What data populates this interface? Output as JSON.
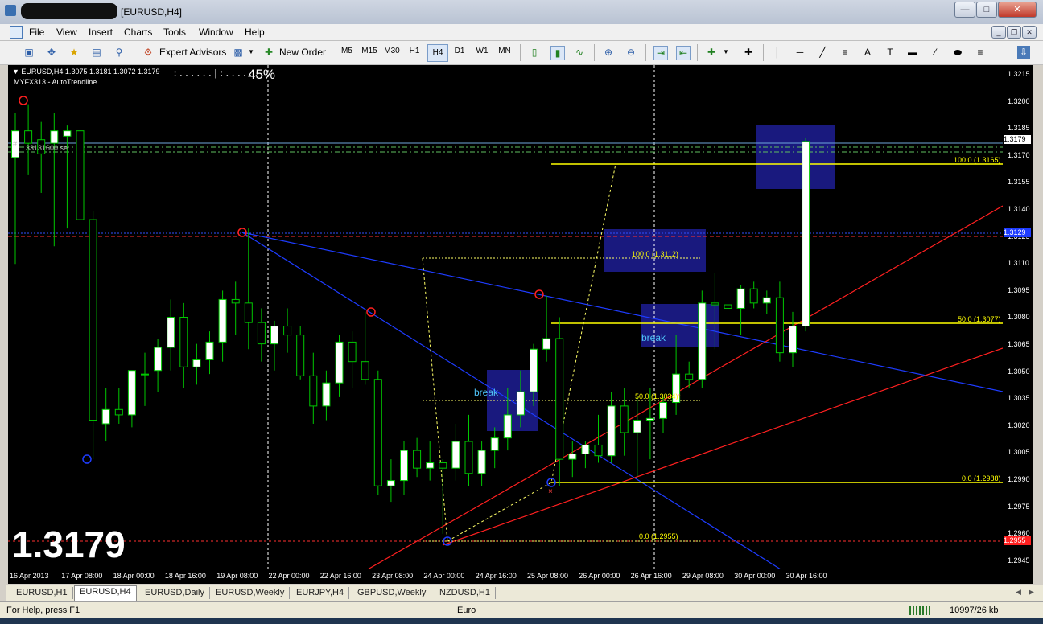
{
  "window": {
    "title": "[EURUSD,H4]"
  },
  "menu": [
    "File",
    "View",
    "Insert",
    "Charts",
    "Tools",
    "Window",
    "Help"
  ],
  "toolbar": {
    "expert_advisors": "Expert Advisors",
    "new_order": "New Order",
    "timeframes": [
      "M5",
      "M15",
      "M30",
      "H1",
      "H4",
      "D1",
      "W1",
      "MN"
    ],
    "active_timeframe": "H4"
  },
  "chart": {
    "header_line": "EURUSD,H4  1.3075 1.3181 1.3072 1.3179",
    "indicator": "MYFX313 - AutoTrendline",
    "progress_text": ":......|:.......:",
    "progress_percent": "45%",
    "big_price": "1.3179",
    "overlay_label_1": "#1",
    "overlay_label_2": "33131600 se",
    "annotations": {
      "break_1": "break",
      "break_2": "break",
      "fib_a_100": "100.0 (1.3165)",
      "fib_a_50": "50.0 (1.3077)",
      "fib_a_0": "0.0 (1.2988)",
      "fib_b_100": "100.0 (1.3112)",
      "fib_b_50": "50.0 (1.3034)",
      "fib_b_0": "0.0 (1.2955)"
    },
    "colors": {
      "bull": "#ffffff",
      "bear": "#000000",
      "wick": "#00c800",
      "fib": "#ffff00",
      "box": "#1c1c8c",
      "blue_line": "#1e3cff",
      "red_line": "#ff2020",
      "break_text": "#4fc3f7"
    }
  },
  "price_axis": {
    "labels": [
      "1.3215",
      "1.3200",
      "1.3185",
      "1.3170",
      "1.3155",
      "1.3140",
      "1.3125",
      "1.3110",
      "1.3095",
      "1.3080",
      "1.3065",
      "1.3050",
      "1.3035",
      "1.3020",
      "1.3005",
      "1.2990",
      "1.2975",
      "1.2960",
      "1.2945"
    ],
    "current_price": "1.3179",
    "red_marker": "1.2955",
    "blue_marker": "1.3129"
  },
  "time_axis": {
    "labels": [
      "16 Apr 2013",
      "17 Apr 08:00",
      "18 Apr 00:00",
      "18 Apr 16:00",
      "19 Apr 08:00",
      "22 Apr 00:00",
      "22 Apr 16:00",
      "23 Apr 08:00",
      "24 Apr 00:00",
      "24 Apr 16:00",
      "25 Apr 08:00",
      "26 Apr 00:00",
      "26 Apr 16:00",
      "29 Apr 08:00",
      "30 Apr 00:00",
      "30 Apr 16:00"
    ]
  },
  "tabs": [
    "EURUSD,H1",
    "EURUSD,H4",
    "EURUSD,Daily",
    "EURUSD,Weekly",
    "EURJPY,H4",
    "GBPUSD,Weekly",
    "NZDUSD,H1"
  ],
  "active_tab": "EURUSD,H4",
  "status": {
    "help": "For Help, press F1",
    "profile": "Euro",
    "traffic": "10997/26 kb"
  },
  "chart_data": {
    "type": "candlestick",
    "symbol": "EURUSD",
    "timeframe": "H4",
    "ylim": [
      1.2938,
      1.3222
    ],
    "candles": [
      {
        "o": 1.317,
        "h": 1.3195,
        "l": 1.311,
        "c": 1.3185
      },
      {
        "o": 1.3185,
        "h": 1.32,
        "l": 1.316,
        "c": 1.3178
      },
      {
        "o": 1.318,
        "h": 1.319,
        "l": 1.315,
        "c": 1.3172
      },
      {
        "o": 1.3178,
        "h": 1.3195,
        "l": 1.312,
        "c": 1.3185
      },
      {
        "o": 1.3182,
        "h": 1.3188,
        "l": 1.313,
        "c": 1.3185
      },
      {
        "o": 1.3185,
        "h": 1.3188,
        "l": 1.314,
        "c": 1.3135
      },
      {
        "o": 1.3135,
        "h": 1.314,
        "l": 1.3,
        "c": 1.3022
      },
      {
        "o": 1.302,
        "h": 1.304,
        "l": 1.301,
        "c": 1.3028
      },
      {
        "o": 1.3028,
        "h": 1.304,
        "l": 1.302,
        "c": 1.3025
      },
      {
        "o": 1.3025,
        "h": 1.3048,
        "l": 1.3018,
        "c": 1.305
      },
      {
        "o": 1.3048,
        "h": 1.306,
        "l": 1.303,
        "c": 1.3048
      },
      {
        "o": 1.305,
        "h": 1.3068,
        "l": 1.3038,
        "c": 1.3063
      },
      {
        "o": 1.3063,
        "h": 1.309,
        "l": 1.305,
        "c": 1.308
      },
      {
        "o": 1.308,
        "h": 1.3088,
        "l": 1.304,
        "c": 1.3052
      },
      {
        "o": 1.3052,
        "h": 1.3065,
        "l": 1.3042,
        "c": 1.3056
      },
      {
        "o": 1.3056,
        "h": 1.3072,
        "l": 1.3048,
        "c": 1.3066
      },
      {
        "o": 1.3066,
        "h": 1.3095,
        "l": 1.3055,
        "c": 1.309
      },
      {
        "o": 1.309,
        "h": 1.31,
        "l": 1.307,
        "c": 1.3088
      },
      {
        "o": 1.3088,
        "h": 1.313,
        "l": 1.3062,
        "c": 1.3077
      },
      {
        "o": 1.3077,
        "h": 1.3085,
        "l": 1.3055,
        "c": 1.3065
      },
      {
        "o": 1.3065,
        "h": 1.3078,
        "l": 1.305,
        "c": 1.3075
      },
      {
        "o": 1.3075,
        "h": 1.3085,
        "l": 1.306,
        "c": 1.307
      },
      {
        "o": 1.307,
        "h": 1.3075,
        "l": 1.3045,
        "c": 1.3047
      },
      {
        "o": 1.3047,
        "h": 1.306,
        "l": 1.302,
        "c": 1.303
      },
      {
        "o": 1.303,
        "h": 1.305,
        "l": 1.3022,
        "c": 1.3043
      },
      {
        "o": 1.3043,
        "h": 1.307,
        "l": 1.3035,
        "c": 1.3066
      },
      {
        "o": 1.3066,
        "h": 1.3072,
        "l": 1.304,
        "c": 1.3055
      },
      {
        "o": 1.3055,
        "h": 1.3083,
        "l": 1.3042,
        "c": 1.3045
      },
      {
        "o": 1.3045,
        "h": 1.305,
        "l": 1.298,
        "c": 1.2985
      },
      {
        "o": 1.2985,
        "h": 1.3,
        "l": 1.2976,
        "c": 1.2988
      },
      {
        "o": 1.2988,
        "h": 1.301,
        "l": 1.298,
        "c": 1.3005
      },
      {
        "o": 1.3005,
        "h": 1.3012,
        "l": 1.299,
        "c": 1.2995
      },
      {
        "o": 1.2995,
        "h": 1.301,
        "l": 1.2988,
        "c": 1.2998
      },
      {
        "o": 1.2998,
        "h": 1.3,
        "l": 1.2958,
        "c": 1.2995
      },
      {
        "o": 1.2995,
        "h": 1.302,
        "l": 1.2988,
        "c": 1.301
      },
      {
        "o": 1.301,
        "h": 1.3025,
        "l": 1.2985,
        "c": 1.2992
      },
      {
        "o": 1.2992,
        "h": 1.301,
        "l": 1.2985,
        "c": 1.3005
      },
      {
        "o": 1.3005,
        "h": 1.3018,
        "l": 1.2995,
        "c": 1.3012
      },
      {
        "o": 1.3012,
        "h": 1.304,
        "l": 1.3005,
        "c": 1.3025
      },
      {
        "o": 1.3025,
        "h": 1.305,
        "l": 1.3018,
        "c": 1.3038
      },
      {
        "o": 1.3038,
        "h": 1.3065,
        "l": 1.303,
        "c": 1.3062
      },
      {
        "o": 1.3062,
        "h": 1.3092,
        "l": 1.3055,
        "c": 1.3068
      },
      {
        "o": 1.3068,
        "h": 1.308,
        "l": 1.2985,
        "c": 1.3
      },
      {
        "o": 1.3,
        "h": 1.301,
        "l": 1.299,
        "c": 1.3003
      },
      {
        "o": 1.3003,
        "h": 1.301,
        "l": 1.2995,
        "c": 1.3008
      },
      {
        "o": 1.3008,
        "h": 1.3025,
        "l": 1.2998,
        "c": 1.3002
      },
      {
        "o": 1.3002,
        "h": 1.3038,
        "l": 1.2998,
        "c": 1.303
      },
      {
        "o": 1.303,
        "h": 1.304,
        "l": 1.3002,
        "c": 1.3015
      },
      {
        "o": 1.3015,
        "h": 1.3035,
        "l": 1.299,
        "c": 1.3022
      },
      {
        "o": 1.3022,
        "h": 1.304,
        "l": 1.3,
        "c": 1.3023
      },
      {
        "o": 1.3023,
        "h": 1.3035,
        "l": 1.3015,
        "c": 1.3032
      },
      {
        "o": 1.3032,
        "h": 1.307,
        "l": 1.3025,
        "c": 1.3048
      },
      {
        "o": 1.3048,
        "h": 1.3055,
        "l": 1.304,
        "c": 1.3045
      },
      {
        "o": 1.3045,
        "h": 1.3095,
        "l": 1.304,
        "c": 1.3088
      },
      {
        "o": 1.3088,
        "h": 1.3105,
        "l": 1.3062,
        "c": 1.3087
      },
      {
        "o": 1.3087,
        "h": 1.3095,
        "l": 1.308,
        "c": 1.3085
      },
      {
        "o": 1.3085,
        "h": 1.3098,
        "l": 1.307,
        "c": 1.3096
      },
      {
        "o": 1.3096,
        "h": 1.31,
        "l": 1.3085,
        "c": 1.3088
      },
      {
        "o": 1.3088,
        "h": 1.3095,
        "l": 1.3082,
        "c": 1.3091
      },
      {
        "o": 1.3091,
        "h": 1.31,
        "l": 1.3055,
        "c": 1.306
      },
      {
        "o": 1.306,
        "h": 1.3083,
        "l": 1.3052,
        "c": 1.3075
      },
      {
        "o": 1.3075,
        "h": 1.3181,
        "l": 1.3072,
        "c": 1.3179
      }
    ]
  }
}
